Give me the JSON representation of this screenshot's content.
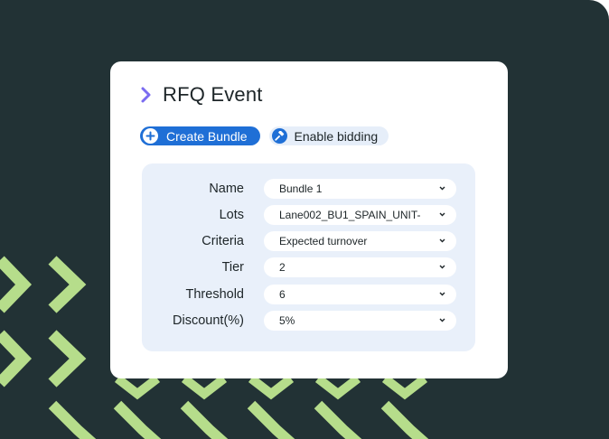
{
  "colors": {
    "background": "#223235",
    "accent_green": "#b6dd8b",
    "primary_blue": "#1f6fd6",
    "chevron_purple": "#7b6cf0",
    "panel": "#e9f0fa"
  },
  "card": {
    "title": "RFQ Event",
    "title_icon": "chevron-right-icon"
  },
  "actions": {
    "create_bundle": {
      "label": "Create Bundle",
      "icon": "plus-circle-icon"
    },
    "enable_bidding": {
      "label": "Enable bidding",
      "icon": "hammer-icon"
    }
  },
  "form": {
    "fields": [
      {
        "label": "Name",
        "value": "Bundle 1"
      },
      {
        "label": "Lots",
        "value": "Lane002_BU1_SPAIN_UNIT-"
      },
      {
        "label": "Criteria",
        "value": "Expected turnover"
      },
      {
        "label": "Tier",
        "value": "2"
      },
      {
        "label": "Threshold",
        "value": "6"
      },
      {
        "label": "Discount(%)",
        "value": "5%"
      }
    ]
  }
}
